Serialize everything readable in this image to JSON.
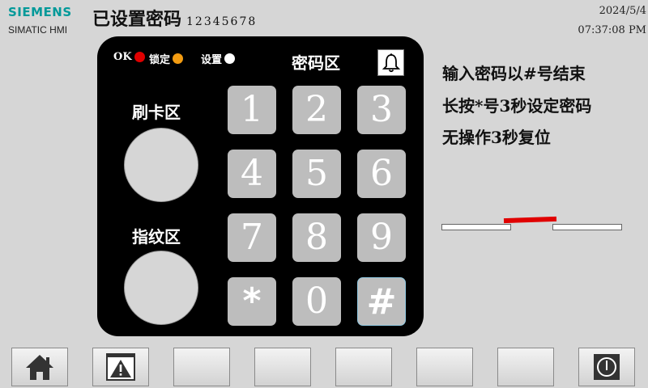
{
  "header": {
    "brand": "SIEMENS",
    "product": "SIMATIC HMI",
    "title": "已设置密码",
    "password_digits": "12345678",
    "date": "2024/5/4",
    "time": "07:37:08 PM"
  },
  "panel": {
    "status": [
      {
        "label": "OK",
        "color": "#e00000"
      },
      {
        "label": "锁定",
        "color": "#f39c12"
      },
      {
        "label": "设置",
        "color": "#ffffff"
      }
    ],
    "password_area_label": "密码区",
    "card_area_label": "刷卡区",
    "fingerprint_area_label": "指纹区",
    "keys": [
      "1",
      "2",
      "3",
      "4",
      "5",
      "6",
      "7",
      "8",
      "9",
      "*",
      "0",
      "#"
    ]
  },
  "instructions": [
    "输入密码以#号结束",
    "长按*号3秒设定密码",
    "无操作3秒复位"
  ],
  "function_keys": [
    "home-icon",
    "warning-icon",
    "",
    "",
    "",
    "",
    "",
    "power-icon"
  ]
}
